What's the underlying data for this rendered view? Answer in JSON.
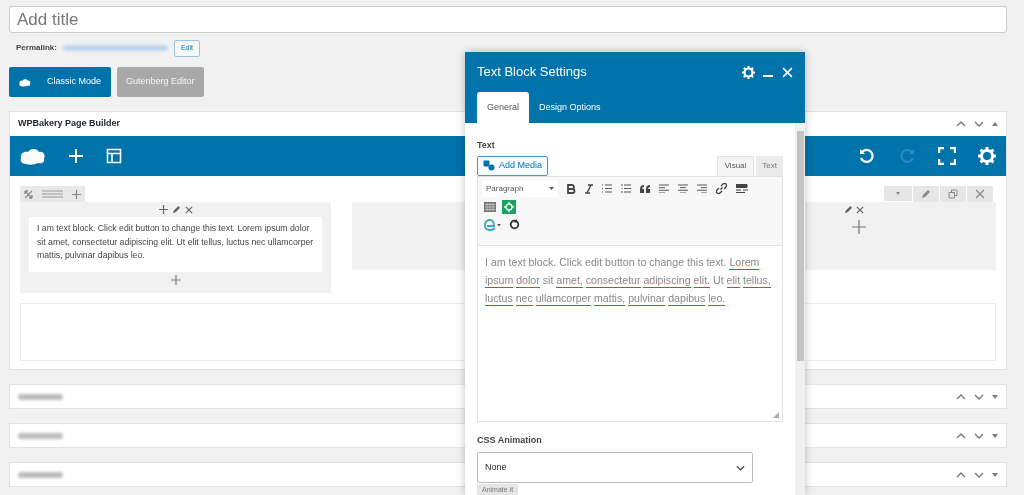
{
  "title_field": {
    "placeholder": "Add title"
  },
  "permalink": {
    "label": "Permalink:",
    "edit_button": "Edit"
  },
  "mode_buttons": [
    {
      "label": "Classic Mode",
      "selected": true
    },
    {
      "label": "Gutenberg Editor",
      "selected": false
    }
  ],
  "page_builder": {
    "title": "WPBakery Page Builder",
    "redo_disabled": true,
    "text_block": "I am text block. Click edit button to change this text. Lorem ipsum dolor sit amet, consectetur adipiscing elit. Ut elit tellus, luctus nec ullamcorper mattis, pulvinar dapibus leo."
  },
  "collapsed_boxes": [
    {
      "kind": "box"
    },
    {
      "kind": "box"
    },
    {
      "kind": "box"
    }
  ],
  "dialog": {
    "title": "Text Block Settings",
    "tabs": [
      {
        "label": "General",
        "selected": true
      },
      {
        "label": "Design Options",
        "selected": false
      }
    ],
    "text_label": "Text",
    "add_media": "Add Media",
    "editor_tabs": [
      {
        "label": "Visual",
        "selected": true
      },
      {
        "label": "Text",
        "selected": false
      }
    ],
    "format_select": "Paragraph",
    "content": [
      {
        "text": "I am text block. Click edit button to change this text.",
        "misspelled": false
      },
      {
        "text": "Lorem",
        "misspelled": true
      },
      {
        "text": "ipsum",
        "misspelled": true
      },
      {
        "text": "dolor",
        "misspelled": true
      },
      {
        "text": "sit",
        "misspelled": false
      },
      {
        "text": "amet,",
        "misspelled": true
      },
      {
        "text": "consectetur",
        "misspelled": true
      },
      {
        "text": "adipiscing",
        "misspelled": true
      },
      {
        "text": "elit.",
        "misspelled": true
      },
      {
        "text": "Ut",
        "misspelled": false
      },
      {
        "text": "elit",
        "misspelled": true
      },
      {
        "text": "tellus,",
        "misspelled": true
      },
      {
        "text": "luctus",
        "misspelled": true
      },
      {
        "text": "nec",
        "misspelled": true
      },
      {
        "text": "ullamcorper",
        "misspelled": true
      },
      {
        "text": "mattis,",
        "misspelled": true
      },
      {
        "text": "pulvinar",
        "misspelled": true
      },
      {
        "text": "dapibus",
        "misspelled": true
      },
      {
        "text": "leo.",
        "misspelled": true
      }
    ],
    "animation_label": "CSS Animation",
    "animation_value": "None",
    "animate_button": "Animate it"
  }
}
